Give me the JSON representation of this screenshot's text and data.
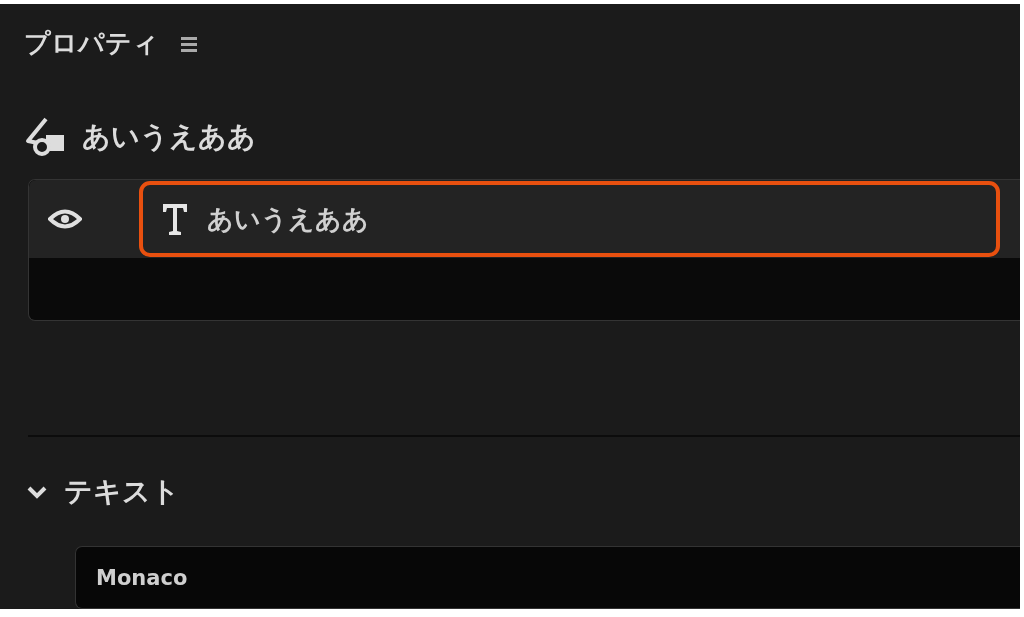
{
  "panel_title": "プロパティ",
  "object": {
    "name": "あいうえああ"
  },
  "layers": [
    {
      "name": "あいうえああ",
      "visible": true,
      "highlighted": true
    }
  ],
  "sections": [
    {
      "title": "テキスト",
      "expanded": true,
      "font": "Monaco"
    }
  ]
}
